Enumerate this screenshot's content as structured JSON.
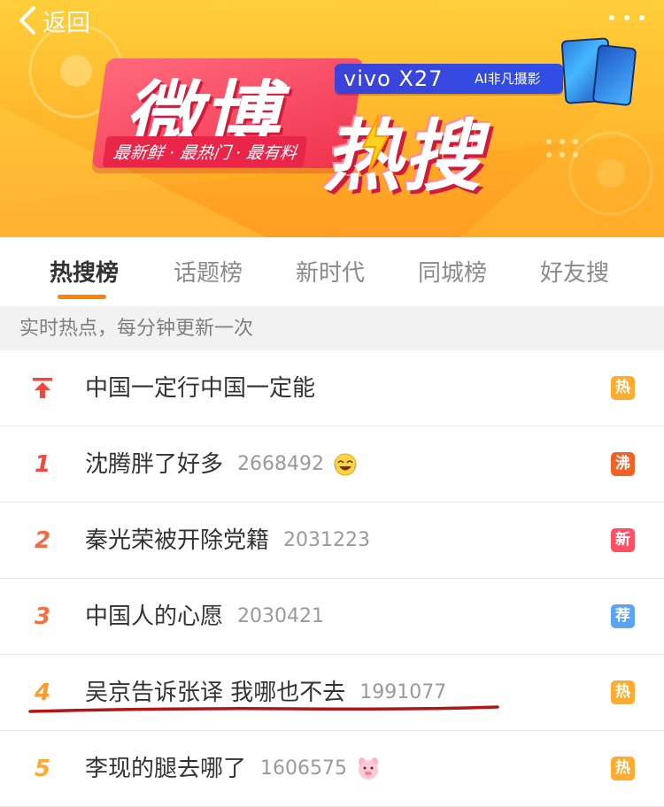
{
  "nav": {
    "back_label": "返回"
  },
  "banner": {
    "title_part1": "微博",
    "title_part2": "热搜",
    "slogan": "最新鲜 · 最热门 · 最有料",
    "ad_model": "vivo X27",
    "ad_tagline": "AI非凡摄影"
  },
  "tabs": [
    {
      "label": "热搜榜"
    },
    {
      "label": "话题榜"
    },
    {
      "label": "新时代"
    },
    {
      "label": "同城榜"
    },
    {
      "label": "好友搜"
    }
  ],
  "active_tab_index": 0,
  "notice": "实时热点，每分钟更新一次",
  "list": [
    {
      "rank": "",
      "pinned": true,
      "title": "中国一定行中国一定能",
      "count": "",
      "badge": "热",
      "emoji": ""
    },
    {
      "rank": "1",
      "pinned": false,
      "title": "沈腾胖了好多",
      "count": "2668492",
      "badge": "沸",
      "emoji": "laugh-cry"
    },
    {
      "rank": "2",
      "pinned": false,
      "title": "秦光荣被开除党籍",
      "count": "2031223",
      "badge": "新",
      "emoji": ""
    },
    {
      "rank": "3",
      "pinned": false,
      "title": "中国人的心愿",
      "count": "2030421",
      "badge": "荐",
      "emoji": ""
    },
    {
      "rank": "4",
      "pinned": false,
      "title": "吴京告诉张译 我哪也不去",
      "count": "1991077",
      "badge": "热",
      "emoji": ""
    },
    {
      "rank": "5",
      "pinned": false,
      "title": "李现的腿去哪了",
      "count": "1606575",
      "badge": "热",
      "emoji": "pig-face"
    }
  ],
  "colors": {
    "accent": "#ff8200",
    "badge_hot": "#ffab2d",
    "badge_boil": "#f26224",
    "badge_new": "#ff4f62",
    "badge_recommend": "#58a4f6",
    "annotation_line": "#b01616"
  }
}
